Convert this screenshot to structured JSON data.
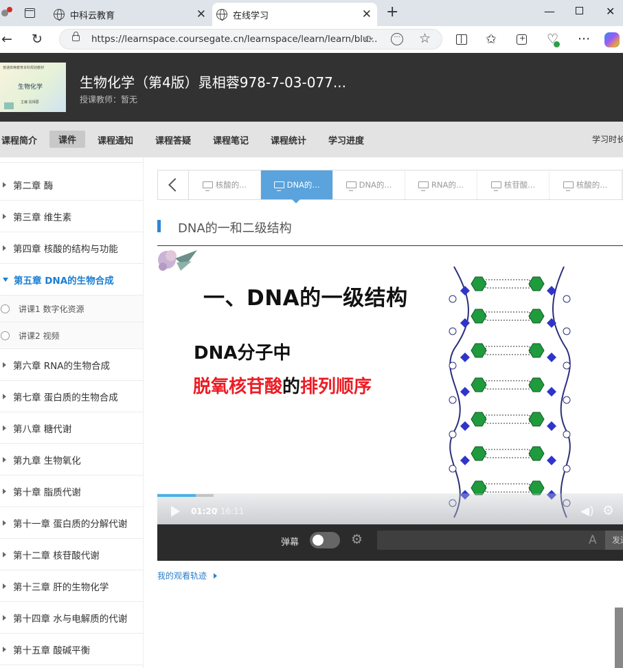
{
  "browser": {
    "tabs": [
      {
        "title": "中科云教育"
      },
      {
        "title": "在线学习"
      }
    ],
    "url": "https://learnspace.coursegate.cn/learnspace/learn/learn/blu..."
  },
  "course": {
    "title": "生物化学（第4版）晁相蓉978-7-03-077...",
    "teacher": "授课教师：暂无",
    "cover": {
      "line1": "普通高等教育本科规划教材",
      "line2": "生物化学",
      "line3": "主编 晁相蓉"
    }
  },
  "nav": {
    "items": [
      "课程简介",
      "课件",
      "课程通知",
      "课程答疑",
      "课程笔记",
      "课程统计",
      "学习进度"
    ],
    "active": "课件",
    "study_time": "学习时长"
  },
  "sidebar": {
    "chapters": [
      {
        "label": "第二章 酶"
      },
      {
        "label": "第三章 维生素"
      },
      {
        "label": "第四章 核酸的结构与功能"
      },
      {
        "label": "第五章 DNA的生物合成"
      },
      {
        "label": "第六章 RNA的生物合成"
      },
      {
        "label": "第七章 蛋白质的生物合成"
      },
      {
        "label": "第八章 糖代谢"
      },
      {
        "label": "第九章 生物氧化"
      },
      {
        "label": "第十章 脂质代谢"
      },
      {
        "label": "第十一章 蛋白质的分解代谢"
      },
      {
        "label": "第十二章 核苷酸代谢"
      },
      {
        "label": "第十三章 肝的生物化学"
      },
      {
        "label": "第十四章 水与电解质的代谢"
      },
      {
        "label": "第十五章 酸碱平衡"
      }
    ],
    "open_chapter": "第五章 DNA的生物合成",
    "sub_items": [
      {
        "label": "讲课1 数字化资源"
      },
      {
        "label": "讲课2 视频"
      }
    ]
  },
  "lesson_tabs": [
    {
      "label": "核酸的..."
    },
    {
      "label": "DNA的..."
    },
    {
      "label": "DNA的..."
    },
    {
      "label": "RNA的..."
    },
    {
      "label": "核苷酸..."
    },
    {
      "label": "核酸的..."
    }
  ],
  "active_lesson_tab": 1,
  "section_title": "DNA的一和二级结构",
  "slide": {
    "heading": "一、DNA的一级结构",
    "line1": "DNA分子中",
    "line2_red1": "脱氧核苷酸",
    "line2_black": "的",
    "line2_red2": "排列顺序"
  },
  "player": {
    "current_time": "01:20",
    "total_time": "/ 16:11",
    "progress_fraction": 0.082
  },
  "danmaku": {
    "label": "弹幕",
    "enabled": false,
    "input_value": "",
    "send_label": "发送"
  },
  "watch_track": "我的观看轨迹",
  "colors": {
    "accent": "#2f86d3",
    "active_tab": "#5aa3dd",
    "red_text": "#ec1c24"
  }
}
